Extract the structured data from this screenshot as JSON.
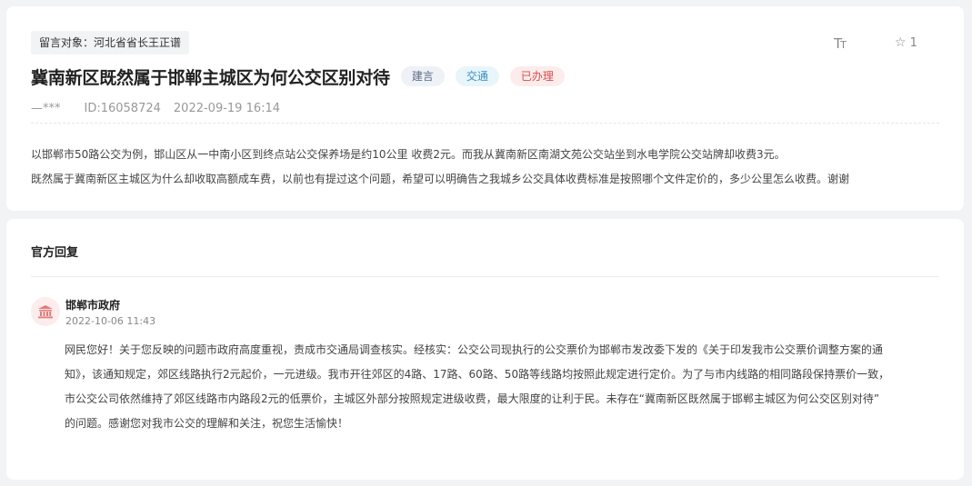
{
  "question": {
    "target_label": "留言对象：河北省省长王正谱",
    "title": "冀南新区既然属于邯郸主城区为何公交区别对待",
    "tags": [
      "建言",
      "交通",
      "已办理"
    ],
    "author": "—***",
    "id_text": "ID:16058724",
    "date": "2022-09-19 16:14",
    "font_tool": "TT",
    "fav_count": "1",
    "body_lines": [
      "以邯郸市50路公交为例，邯山区从一中南小区到终点站公交保养场是约10公里 收费2元。而我从冀南新区南湖文苑公交站坐到水电学院公交站牌却收费3元。",
      "既然属于冀南新区主城区为什么却收取高额成车费，以前也有提过这个问题，希望可以明确告之我城乡公交具体收费标准是按照哪个文件定价的，多少公里怎么收费。谢谢"
    ]
  },
  "reply": {
    "heading": "官方回复",
    "org_name": "邯郸市政府",
    "date": "2022-10-06 11:43",
    "body_lines": [
      "网民您好！关于您反映的问题市政府高度重视，责成市交通局调查核实。经核实：公交公司现执行的公交票价为邯郸市发改委下发的《关于印发我市公交票价调整方案的通",
      "知》，该通知规定，郊区线路执行2元起价，一元进级。我市开往郊区的4路、17路、60路、50路等线路均按照此规定进行定价。为了与市内线路的相同路段保持票价一致，",
      "市公交公司依然维持了郊区线路市内路段2元的低票价，主城区外部分按照规定进级收费，最大限度的让利于民。未存在“冀南新区既然属于邯郸主城区为何公交区别对待”",
      "的问题。感谢您对我市公交的理解和关注，祝您生活愉快！"
    ]
  },
  "colors": {
    "accent_red": "#d94a4a",
    "page_bg": "#f2f3f5"
  },
  "icons": {
    "font_size": "font-size-icon",
    "favorite": "star-icon",
    "org": "government-building-icon"
  }
}
